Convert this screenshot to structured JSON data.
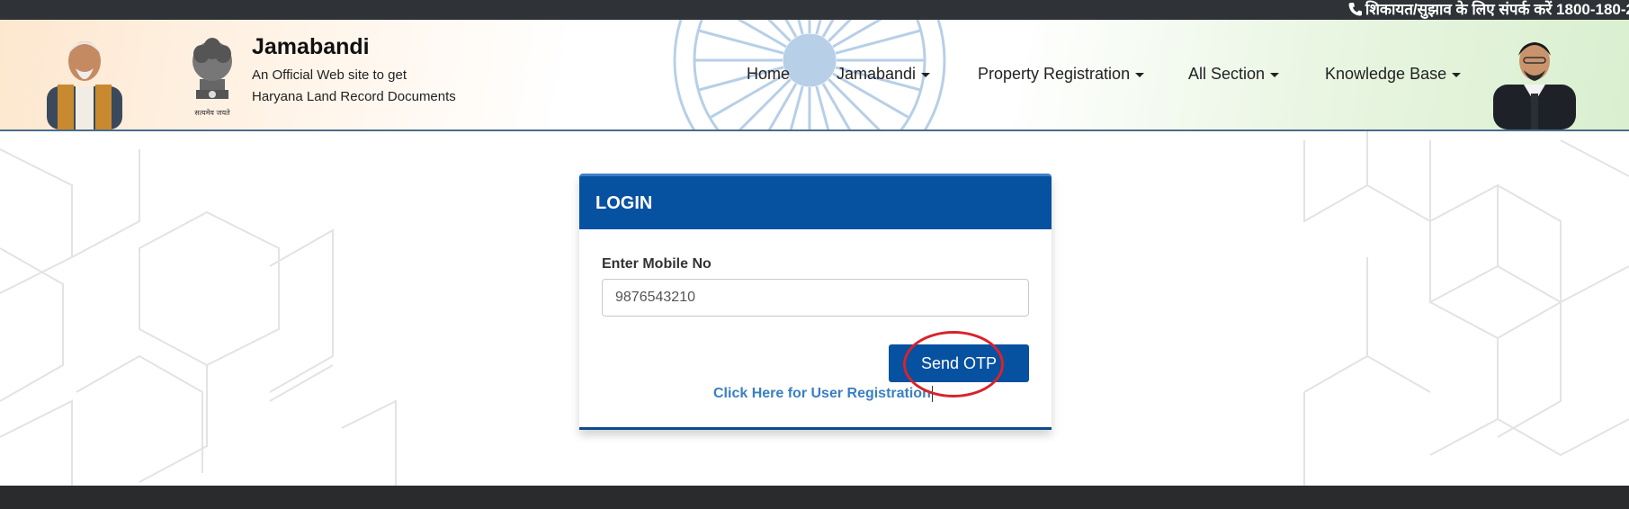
{
  "topbar": {
    "helpline": "शिकायत/सुझाव के लिए संपर्क करें 1800-180-2",
    "phone_icon": "phone-icon"
  },
  "header": {
    "site_title": "Jamabandi",
    "site_subtitle_line1": "An Official Web site to get",
    "site_subtitle_line2": "Haryana Land Record Documents",
    "emblem_motto": "सत्यमेव जयते",
    "nav": [
      {
        "label": "Home",
        "dropdown": false
      },
      {
        "label": "Jamabandi",
        "dropdown": true
      },
      {
        "label": "Property Registration",
        "dropdown": true
      },
      {
        "label": "All Section",
        "dropdown": true
      },
      {
        "label": "Knowledge Base",
        "dropdown": true
      }
    ]
  },
  "login": {
    "title": "LOGIN",
    "mobile_label": "Enter Mobile No",
    "mobile_value": "9876543210",
    "send_otp_label": "Send OTP",
    "registration_link": "Click Here for User Registration"
  },
  "colors": {
    "primary": "#0751a1",
    "link": "#3a7fc4",
    "highlight": "#d8232a",
    "topbar": "#2f3337"
  }
}
